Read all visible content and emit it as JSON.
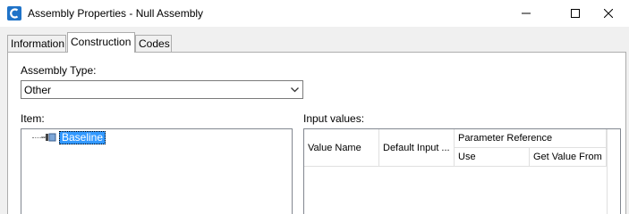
{
  "window": {
    "title": "Assembly Properties - Null Assembly",
    "app_icon": "civil3d-app-icon",
    "controls": [
      "minimize-icon",
      "maximize-icon",
      "close-icon"
    ]
  },
  "tabs": [
    {
      "label": "Information",
      "selected": false
    },
    {
      "label": "Construction",
      "selected": true
    },
    {
      "label": "Codes",
      "selected": false
    }
  ],
  "construction": {
    "assembly_type_label": "Assembly Type:",
    "assembly_type_value": "Other",
    "item_label": "Item:",
    "tree": {
      "items": [
        {
          "label": "Baseline",
          "icon": "baseline-icon",
          "selected": true
        }
      ]
    },
    "input_values_label": "Input values:",
    "grid": {
      "columns": {
        "value_name": "Value Name",
        "default_input": "Default Input ...",
        "parameter_reference": "Parameter Reference",
        "use": "Use",
        "get_value_from": "Get Value From"
      },
      "rows": []
    }
  },
  "colors": {
    "selection": "#3399ff",
    "dialog_bg": "#f0f0f0",
    "app_icon_blue": "#1f73c8"
  }
}
